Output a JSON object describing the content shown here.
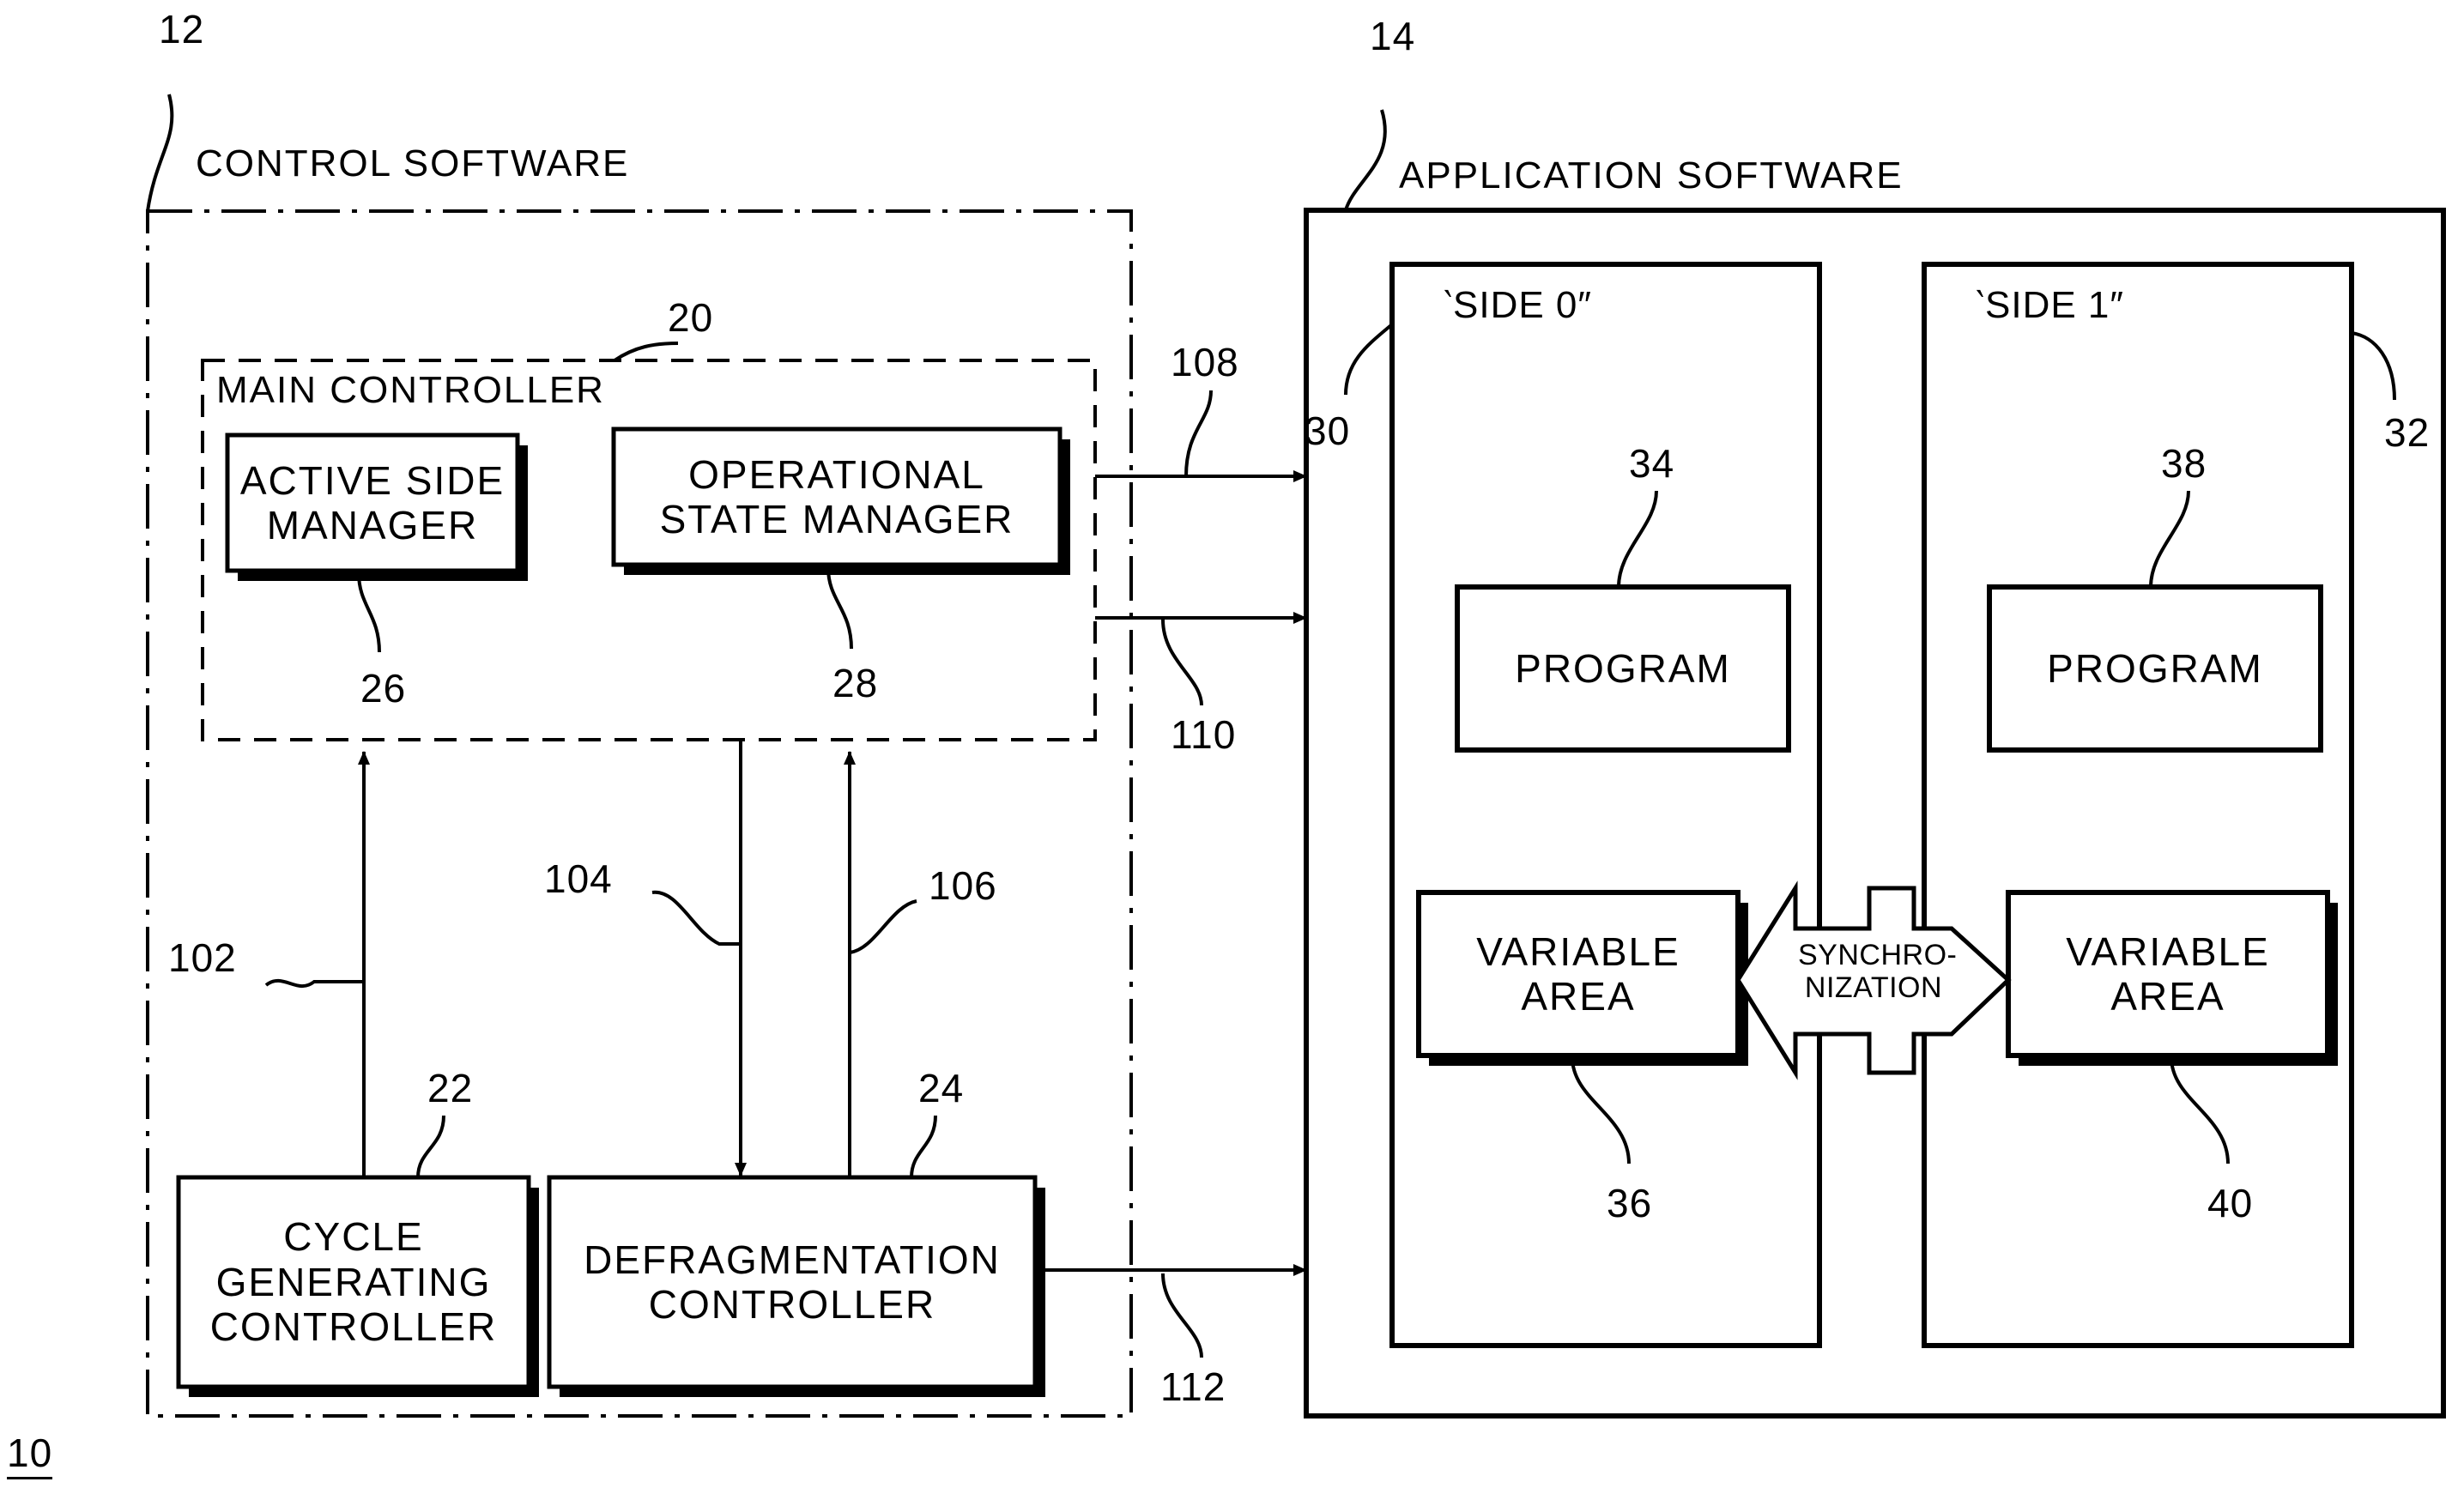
{
  "figure": {
    "number": "10",
    "type": "patent-block-diagram"
  },
  "sections": {
    "control_software": {
      "title": "CONTROL SOFTWARE",
      "ref": "12",
      "border_style": "dash-dot"
    },
    "application_software": {
      "title": "APPLICATION SOFTWARE",
      "ref": "14",
      "border_style": "solid"
    }
  },
  "main_controller": {
    "title": "MAIN CONTROLLER",
    "ref": "20",
    "border_style": "dashed"
  },
  "blocks": [
    {
      "key": "active_side_manager",
      "label": "ACTIVE SIDE\nMANAGER",
      "ref": "26",
      "shadow": true
    },
    {
      "key": "operational_state_manager",
      "label": "OPERATIONAL\nSTATE MANAGER",
      "ref": "28",
      "shadow": true
    },
    {
      "key": "cycle_generating_controller",
      "label": "CYCLE\nGENERATING\nCONTROLLER",
      "ref": "22",
      "shadow": true
    },
    {
      "key": "defragmentation_controller",
      "label": "DEFRAGMENTATION\nCONTROLLER",
      "ref": "24",
      "shadow": true
    },
    {
      "key": "program_side0",
      "label": "PROGRAM",
      "ref": "34",
      "shadow": false
    },
    {
      "key": "program_side1",
      "label": "PROGRAM",
      "ref": "38",
      "shadow": false
    },
    {
      "key": "variable_area_side0",
      "label": "VARIABLE\nAREA",
      "ref": "36",
      "shadow": true
    },
    {
      "key": "variable_area_side1",
      "label": "VARIABLE\nAREA",
      "ref": "40",
      "shadow": true
    }
  ],
  "panels": [
    {
      "key": "side0",
      "label": "‵SIDE 0″",
      "ref": "30"
    },
    {
      "key": "side1",
      "label": "‵SIDE 1″",
      "ref": "32"
    }
  ],
  "sync_arrow": {
    "label": "SYNCHRO-\nNIZATION",
    "direction": "bidirectional"
  },
  "connectors": [
    {
      "ref": "102",
      "from": "cycle_generating_controller",
      "to": "main_controller",
      "direction": "up"
    },
    {
      "ref": "104",
      "from": "main_controller",
      "to": "defragmentation_controller",
      "direction": "down"
    },
    {
      "ref": "106",
      "from": "defragmentation_controller",
      "to": "main_controller",
      "direction": "up"
    },
    {
      "ref": "108",
      "from": "main_controller",
      "to": "application_software",
      "direction": "right"
    },
    {
      "ref": "110",
      "from": "main_controller",
      "to": "application_software",
      "direction": "right"
    },
    {
      "ref": "112",
      "from": "defragmentation_controller",
      "to": "application_software",
      "direction": "right"
    }
  ],
  "colors": {
    "ink": "#000000",
    "paper": "#ffffff"
  }
}
